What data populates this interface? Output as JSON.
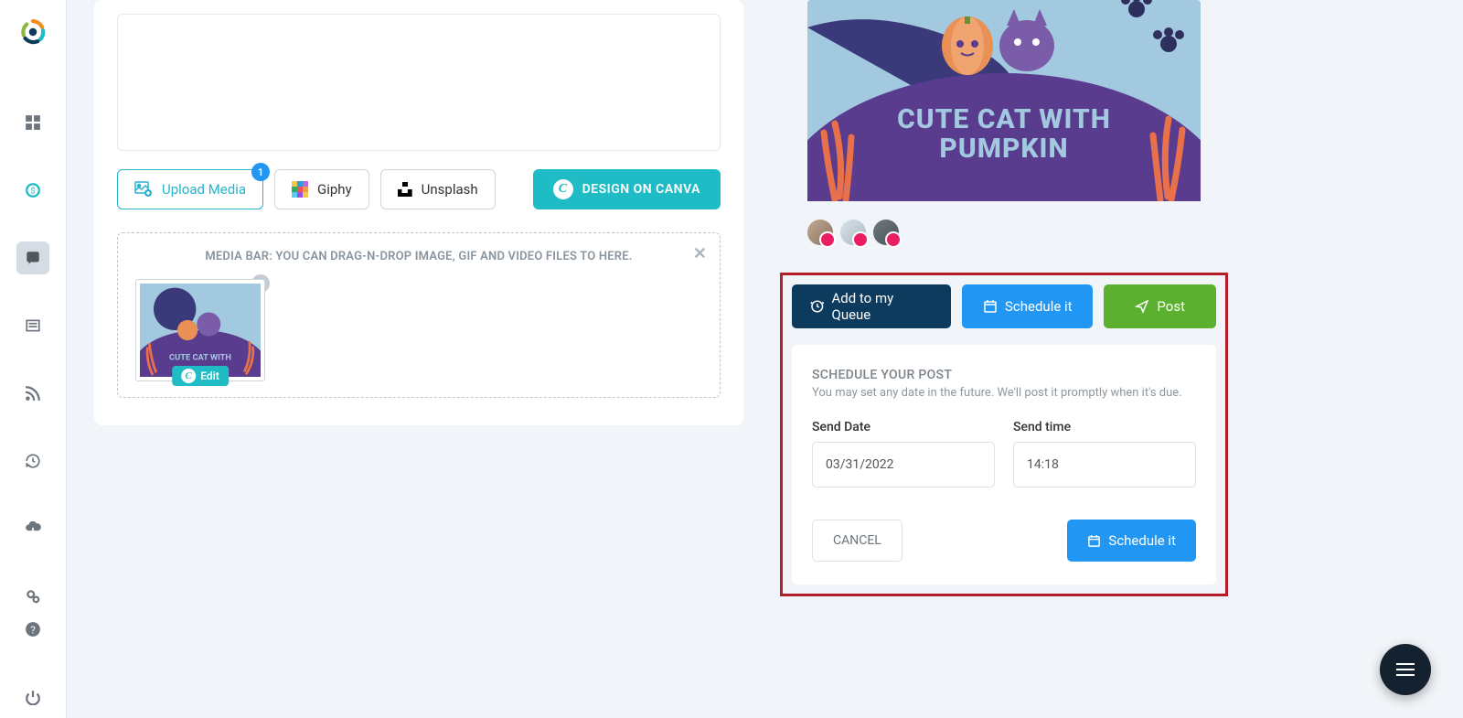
{
  "sidebar": {
    "items": [
      {
        "name": "dashboard-icon"
      },
      {
        "name": "billing-icon"
      },
      {
        "name": "compose-icon",
        "active": true
      },
      {
        "name": "news-icon"
      },
      {
        "name": "rss-icon"
      },
      {
        "name": "history-icon"
      },
      {
        "name": "download-icon"
      },
      {
        "name": "settings-icon"
      }
    ],
    "bottom": [
      {
        "name": "help-icon"
      },
      {
        "name": "power-icon"
      }
    ]
  },
  "media_buttons": {
    "upload": "Upload Media",
    "upload_badge": "1",
    "giphy": "Giphy",
    "unsplash": "Unsplash",
    "canva": "DESIGN ON CANVA"
  },
  "media_bar": {
    "title": "MEDIA BAR: YOU CAN DRAG-N-DROP IMAGE, GIF AND VIDEO FILES TO HERE.",
    "thumb_edit": "Edit",
    "thumb_caption": "CUTE CAT WITH"
  },
  "preview": {
    "caption_line1": "CUTE CAT WITH",
    "caption_line2": "PUMPKIN"
  },
  "action_tabs": {
    "queue": "Add to my Queue",
    "schedule": "Schedule it",
    "post": "Post"
  },
  "schedule_panel": {
    "heading": "SCHEDULE YOUR POST",
    "sub": "You may set any date in the future. We'll post it promptly when it's due.",
    "date_label": "Send Date",
    "date_value": "03/31/2022",
    "time_label": "Send time",
    "time_value": "14:18",
    "cancel": "CANCEL",
    "submit": "Schedule it"
  }
}
